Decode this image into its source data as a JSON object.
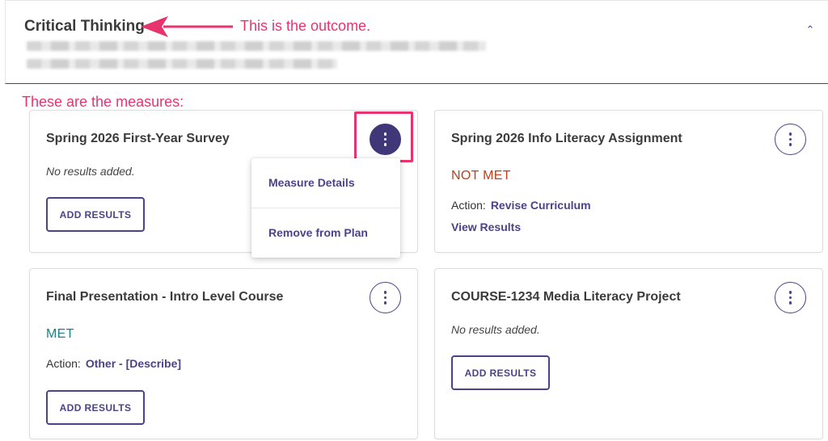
{
  "outcome": {
    "title": "Critical Thinking"
  },
  "annotations": {
    "outcome_note": "This is the outcome.",
    "measures_note": "These are the measures:",
    "color": "#e8346e"
  },
  "measures": [
    {
      "title": "Spring 2026 First-Year Survey",
      "no_results": "No results added.",
      "add_results_label": "ADD RESULTS"
    },
    {
      "title": "Spring 2026 Info Literacy Assignment",
      "status": "NOT MET",
      "action_label": "Action:",
      "action_value": "Revise Curriculum",
      "view_results_label": "View Results"
    },
    {
      "title": "Final Presentation - Intro Level Course",
      "status": "MET",
      "action_label": "Action:",
      "action_value": "Other - [Describe]",
      "add_results_label": "ADD RESULTS"
    },
    {
      "title": "COURSE-1234 Media Literacy Project",
      "no_results": "No results added.",
      "add_results_label": "ADD RESULTS"
    }
  ],
  "menu": {
    "items": [
      {
        "label": "Measure Details"
      },
      {
        "label": "Remove from Plan"
      }
    ]
  },
  "colors": {
    "accent": "#4a4388",
    "not_met": "#c23d19",
    "met": "#1b7f8c"
  }
}
